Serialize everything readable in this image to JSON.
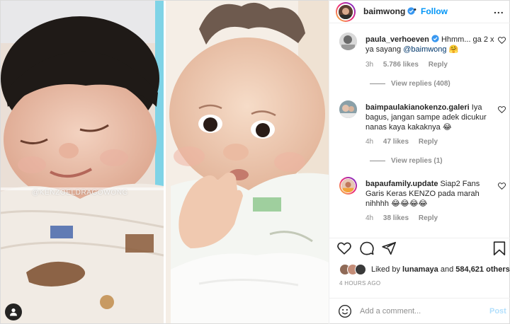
{
  "photo": {
    "watermark": "@KENZOELDRAGOWONG"
  },
  "header": {
    "username": "baimwong",
    "separator": "•",
    "follow_label": "Follow",
    "more_label": "..."
  },
  "comments": [
    {
      "username": "paula_verhoeven",
      "verified": true,
      "text": "Hhmm... ga 2 x ya sayang",
      "mention": "@baimwong",
      "emoji": "🤗",
      "time": "3h",
      "likes": "5.786 likes",
      "reply_label": "Reply",
      "view_replies": "View replies (408)"
    },
    {
      "username": "baimpaulakianokenzo.galeri",
      "verified": false,
      "text": "Iya bagus, jangan sampe adek dicukur nanas kaya kakaknya",
      "emoji": "😂",
      "time": "4h",
      "likes": "47 likes",
      "reply_label": "Reply",
      "view_replies": "View replies (1)"
    },
    {
      "username": "bapaufamily.update",
      "verified": false,
      "text": "Siap2 Fans Garis Keras KENZO pada marah nihhhh",
      "emoji": "😂😂😂😂",
      "time": "4h",
      "likes": "38 likes",
      "reply_label": "Reply"
    }
  ],
  "likes": {
    "prefix": "Liked by",
    "user": "lunamaya",
    "and": "and",
    "count": "584,621 others"
  },
  "timestamp": "4 HOURS AGO",
  "add_comment": {
    "placeholder": "Add a comment...",
    "post_label": "Post"
  },
  "colors": {
    "link_blue": "#0095f6",
    "mention_blue": "#00376b",
    "muted": "#8e8e8e",
    "post_disabled": "#b2dffc"
  },
  "icons": [
    "user-tag-icon",
    "verified-badge-icon",
    "heart-icon",
    "comment-icon",
    "share-icon",
    "bookmark-icon",
    "emoji-icon"
  ]
}
